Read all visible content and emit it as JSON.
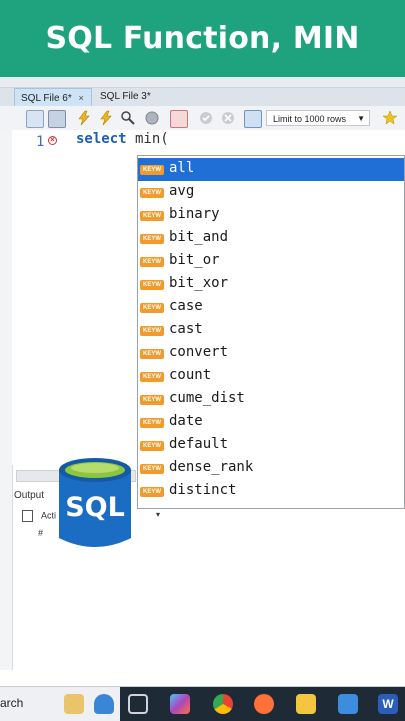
{
  "banner": {
    "title": "SQL Function, MIN"
  },
  "tabs": [
    {
      "label": "SQL File 6*",
      "close": "×"
    },
    {
      "label": "SQL File 3*"
    }
  ],
  "toolbar": {
    "limit_label": "Limit to 1000 rows"
  },
  "editor": {
    "line_number": "1",
    "code_keyword": "select",
    "code_rest": " min("
  },
  "autocomplete": {
    "badge_text": "KEYW",
    "items": [
      "all",
      "avg",
      "binary",
      "bit_and",
      "bit_or",
      "bit_xor",
      "case",
      "cast",
      "convert",
      "count",
      "cume_dist",
      "date",
      "default",
      "dense_rank",
      "distinct"
    ],
    "selected_index": 0
  },
  "output": {
    "title": "Output",
    "action_label": "Acti",
    "hash_label": "#"
  },
  "logo": {
    "text": "SQL"
  },
  "taskbar": {
    "search_text": "arch"
  },
  "colors": {
    "banner": "#1fa37f",
    "selection": "#1f6fd6",
    "keyword_badge": "#f29b2c",
    "keyword_text": "#1d5fb0"
  }
}
